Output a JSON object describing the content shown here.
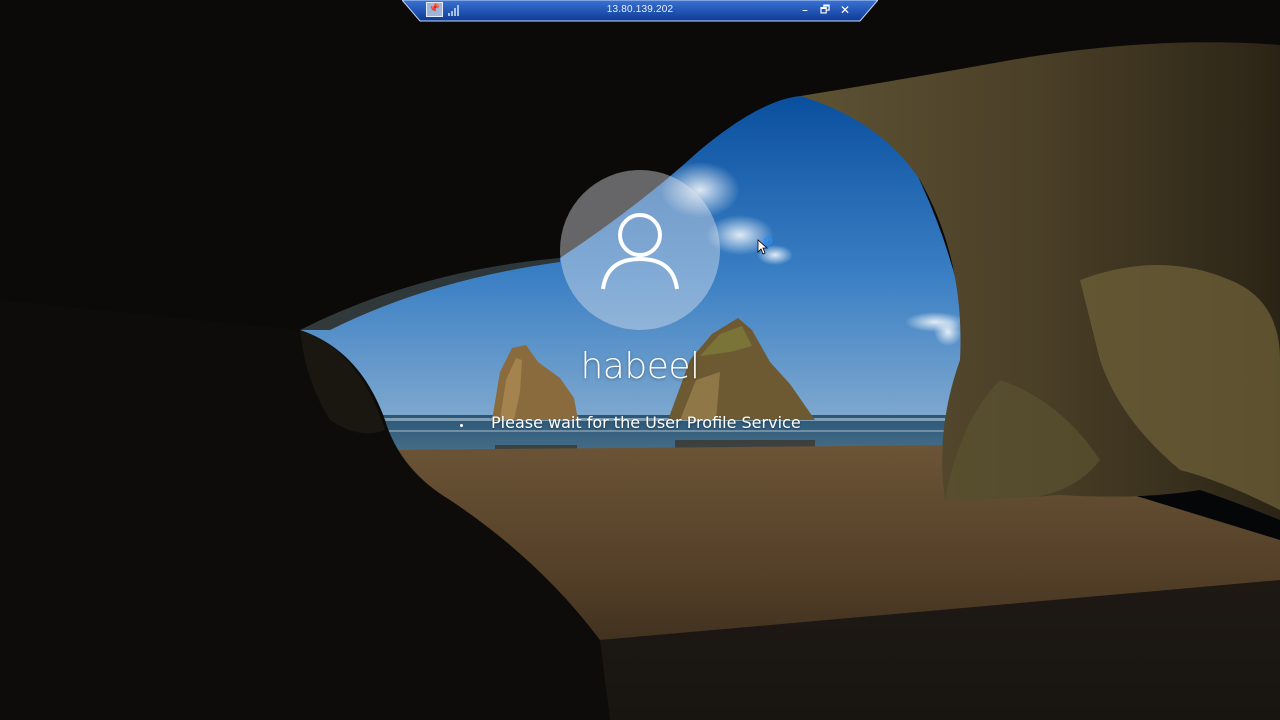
{
  "remote_session": {
    "address": "13.80.139.202",
    "pin_icon": "pin-icon",
    "signal_icon": "connection-signal-icon",
    "minimize_label": "–",
    "restore_label": "🗗",
    "close_label": "✕"
  },
  "lock_screen": {
    "avatar_icon": "user-icon",
    "username": "habeel",
    "status_message": "Please wait for the User Profile Service",
    "busy_icon": "busy-spinner-icon"
  },
  "cursor_icon": "busy-pointer-icon",
  "colors": {
    "rdp_bar_top": "#2c61c3",
    "rdp_bar_bottom": "#0f3d9a",
    "rdp_bar_border": "#c9d8f2",
    "text": "#ffffff",
    "avatar_fill": "#e4e8ee",
    "busy_ring": "#1e90ff"
  }
}
